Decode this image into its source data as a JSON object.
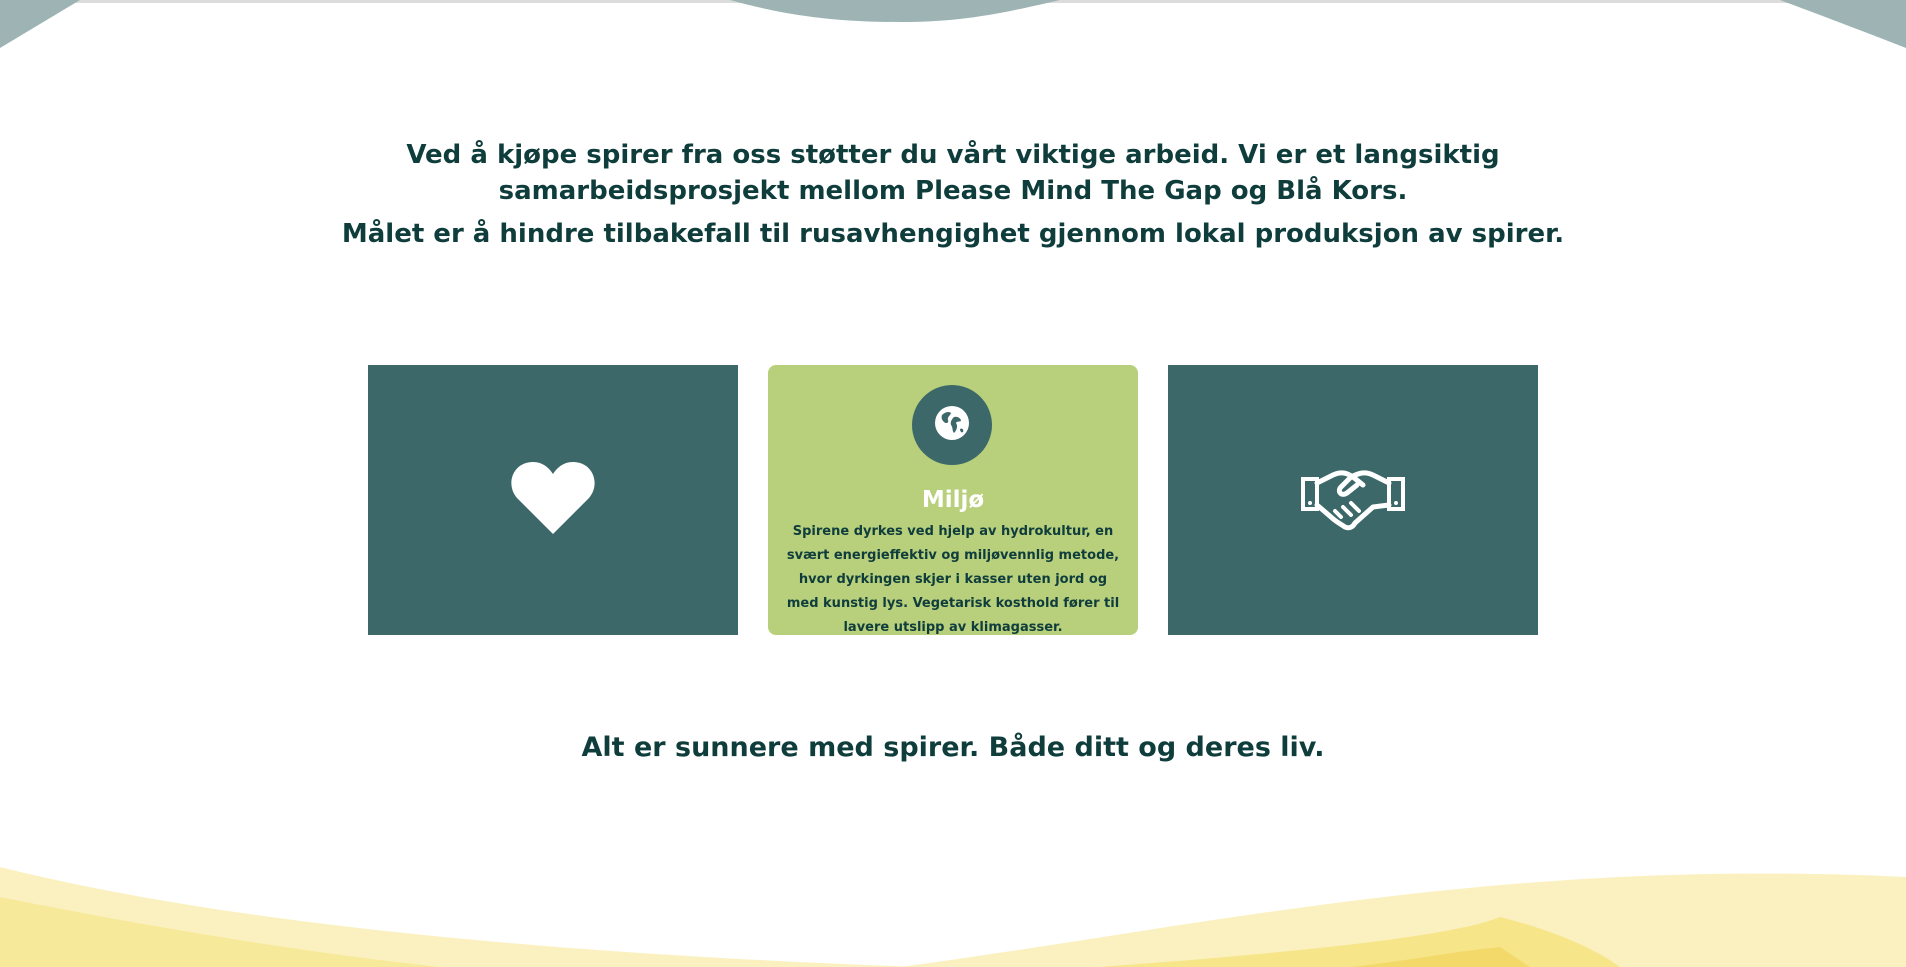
{
  "intro": {
    "line1": "Ved å kjøpe spirer fra oss støtter du vårt viktige arbeid. Vi er et langsiktig samarbeidsprosjekt mellom Please Mind The Gap og Blå Kors.",
    "line2": "Målet er å hindre tilbakefall til rusavhengighet gjennom lokal produksjon av spirer."
  },
  "cards": [
    {
      "icon": "heart-icon"
    },
    {
      "icon": "globe-icon",
      "title": "Miljø",
      "text": "Spirene dyrkes ved hjelp av hydrokultur, en svært energieffektiv og miljøvennlig metode, hvor dyrkingen skjer i kasser uten jord og med kunstig lys. Vegetarisk kosthold fører til lavere utslipp av klimagasser."
    },
    {
      "icon": "handshake-icon"
    }
  ],
  "closing": "Alt er sunnere med spirer. Både ditt og deres liv.",
  "colors": {
    "dark_teal": "#3d6869",
    "text": "#0f3d3c",
    "green_card": "#b8cf7b",
    "wave_top": "#9eb4b4",
    "wave_yellow": "#f7e58a"
  }
}
